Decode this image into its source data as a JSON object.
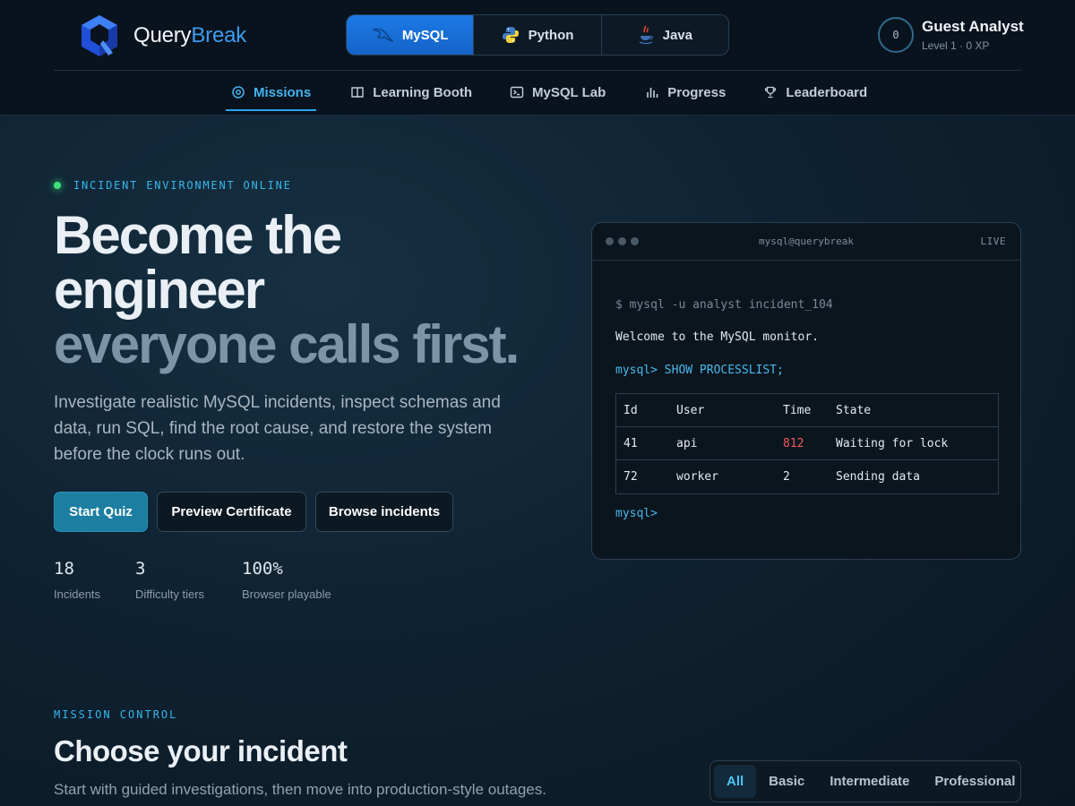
{
  "brand": {
    "name_part1": "Query",
    "name_part2": "Break"
  },
  "languages": [
    {
      "label": "MySQL",
      "icon": "mysql-dolphin-icon",
      "active": true
    },
    {
      "label": "Python",
      "icon": "python-icon",
      "active": false
    },
    {
      "label": "Java",
      "icon": "java-cup-icon",
      "active": false
    }
  ],
  "user": {
    "badge": "0",
    "name": "Guest Analyst",
    "level": "Level 1 · 0 XP"
  },
  "nav": [
    {
      "label": "Missions",
      "icon": "target-icon",
      "active": true
    },
    {
      "label": "Learning Booth",
      "icon": "book-icon",
      "active": false
    },
    {
      "label": "MySQL Lab",
      "icon": "terminal-icon",
      "active": false
    },
    {
      "label": "Progress",
      "icon": "bar-chart-icon",
      "active": false
    },
    {
      "label": "Leaderboard",
      "icon": "trophy-icon",
      "active": false
    }
  ],
  "hero": {
    "status": "INCIDENT ENVIRONMENT ONLINE",
    "headline_line1": "Become the",
    "headline_line2": "engineer",
    "headline_line3": "everyone calls first.",
    "lead": "Investigate realistic MySQL incidents, inspect schemas and data, run SQL, find the root cause, and restore the system before the clock runs out.",
    "buttons": {
      "start": "Start Quiz",
      "certificate": "Preview Certificate",
      "browse": "Browse incidents"
    },
    "stats": [
      {
        "value": "18",
        "label": "Incidents"
      },
      {
        "value": "3",
        "label": "Difficulty tiers"
      },
      {
        "value": "100%",
        "label": "Browser playable"
      }
    ]
  },
  "terminal": {
    "title": "mysql@querybreak",
    "live": "LIVE",
    "command": "$ mysql -u analyst incident_104",
    "welcome": "Welcome to the MySQL monitor.",
    "query": "mysql> SHOW PROCESSLIST;",
    "columns": [
      "Id",
      "User",
      "Time",
      "State"
    ],
    "rows": [
      [
        "41",
        "api",
        "812",
        "Waiting for lock"
      ],
      [
        "72",
        "worker",
        "2",
        "Sending data"
      ]
    ],
    "prompt": "mysql>"
  },
  "missions": {
    "kicker": "MISSION CONTROL",
    "title": "Choose your incident",
    "subtitle": "Start with guided investigations, then move into production-style outages.",
    "filters": [
      "All",
      "Basic",
      "Intermediate",
      "Professional"
    ],
    "active_filter": "All"
  },
  "colors": {
    "accent": "#38b6e8",
    "primary_button": "#1c7ea0",
    "active_lang": "#1d7ae6",
    "status_online": "#3ee17a",
    "warn": "#f25b64"
  }
}
